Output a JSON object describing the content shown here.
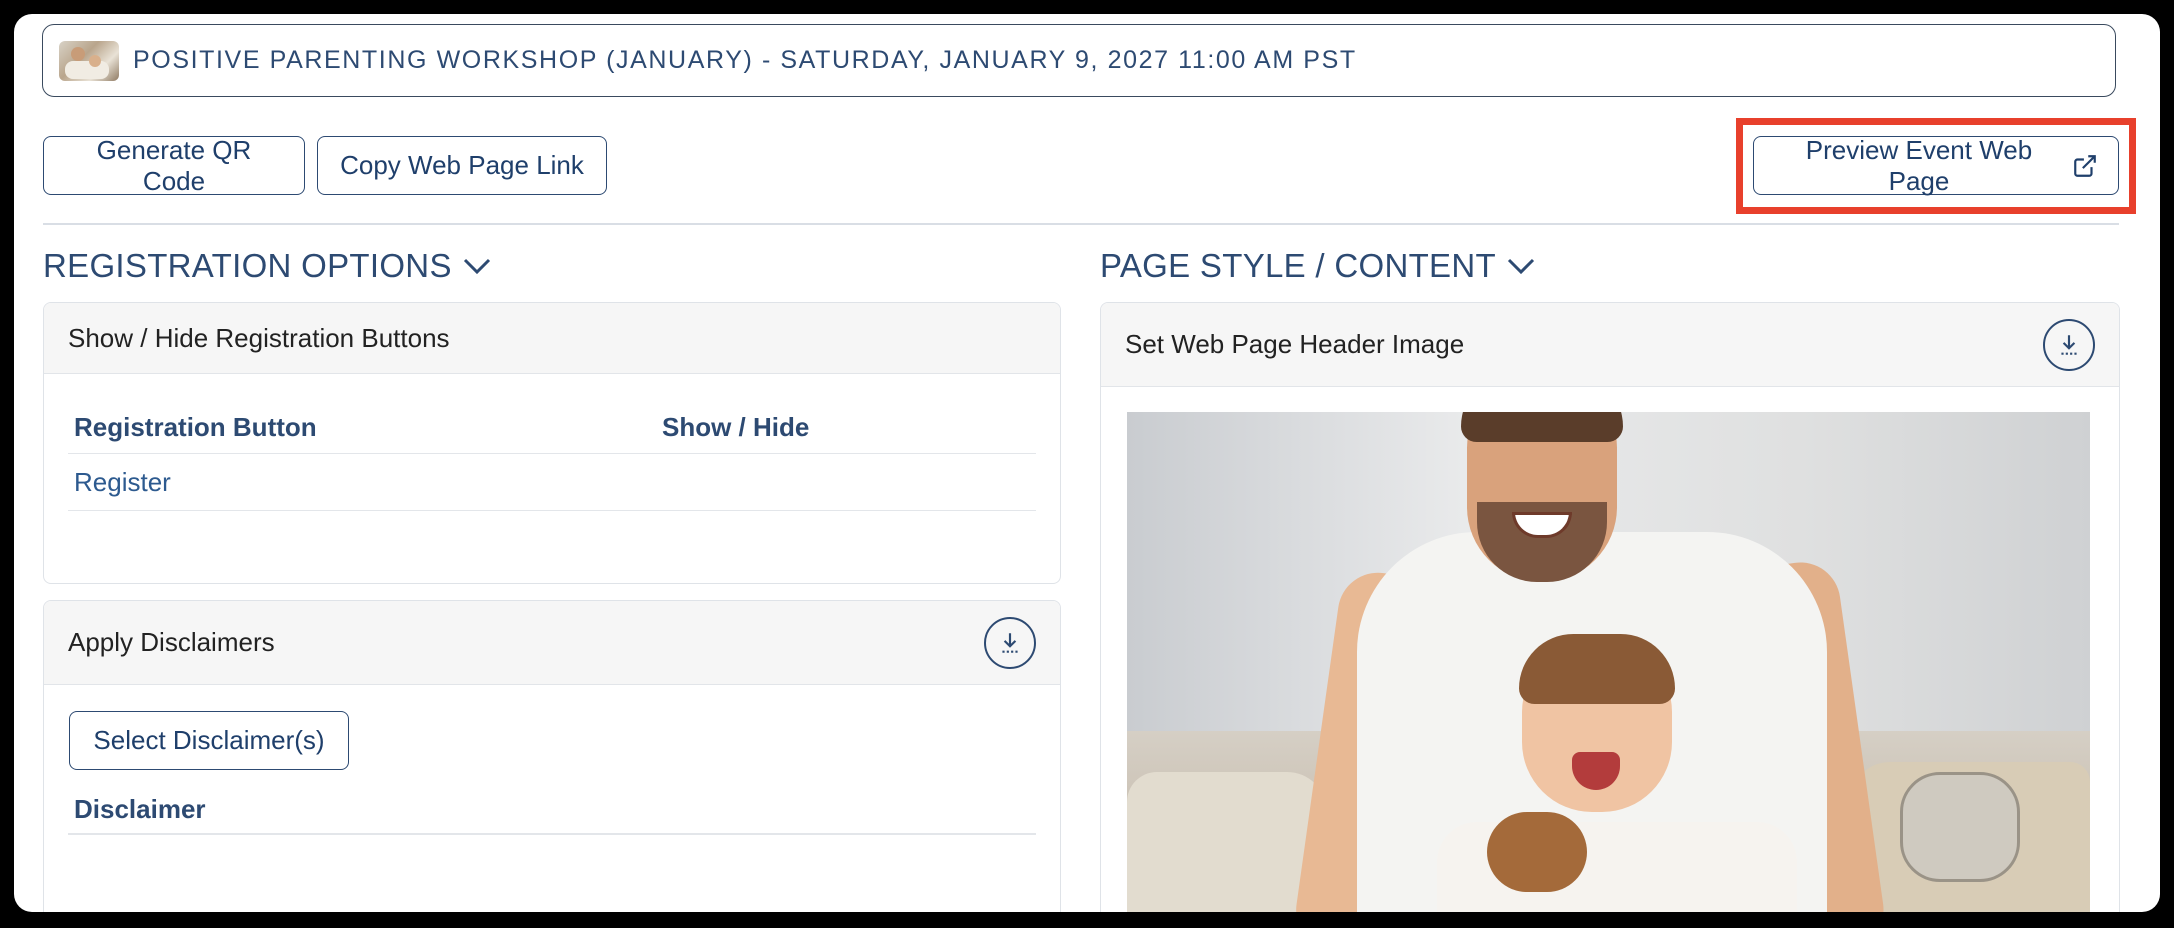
{
  "event": {
    "title": "POSITIVE PARENTING WORKSHOP (JANUARY) - SATURDAY, JANUARY 9, 2027 11:00 AM PST"
  },
  "toolbar": {
    "generate_qr": "Generate QR Code",
    "copy_link": "Copy Web Page Link",
    "preview": "Preview Event Web Page"
  },
  "registration_options": {
    "heading": "REGISTRATION OPTIONS",
    "buttons_panel": {
      "title": "Show / Hide Registration Buttons",
      "columns": [
        "Registration Button",
        "Show / Hide"
      ],
      "rows": [
        {
          "button": "Register",
          "show_hide": ""
        }
      ]
    },
    "disclaimers_panel": {
      "title": "Apply Disclaimers",
      "select_button": "Select Disclaimer(s)",
      "column": "Disclaimer"
    }
  },
  "page_style": {
    "heading": "PAGE STYLE / CONTENT",
    "header_image_panel": {
      "title": "Set Web Page Header Image"
    }
  },
  "colors": {
    "accent": "#2d4a72",
    "highlight": "#e8402c",
    "panel_header_bg": "#f6f6f6"
  },
  "icons": {
    "heading_chevron": "chevron-down-icon",
    "preview_external": "external-link-icon",
    "panel_action": "download-icon"
  }
}
